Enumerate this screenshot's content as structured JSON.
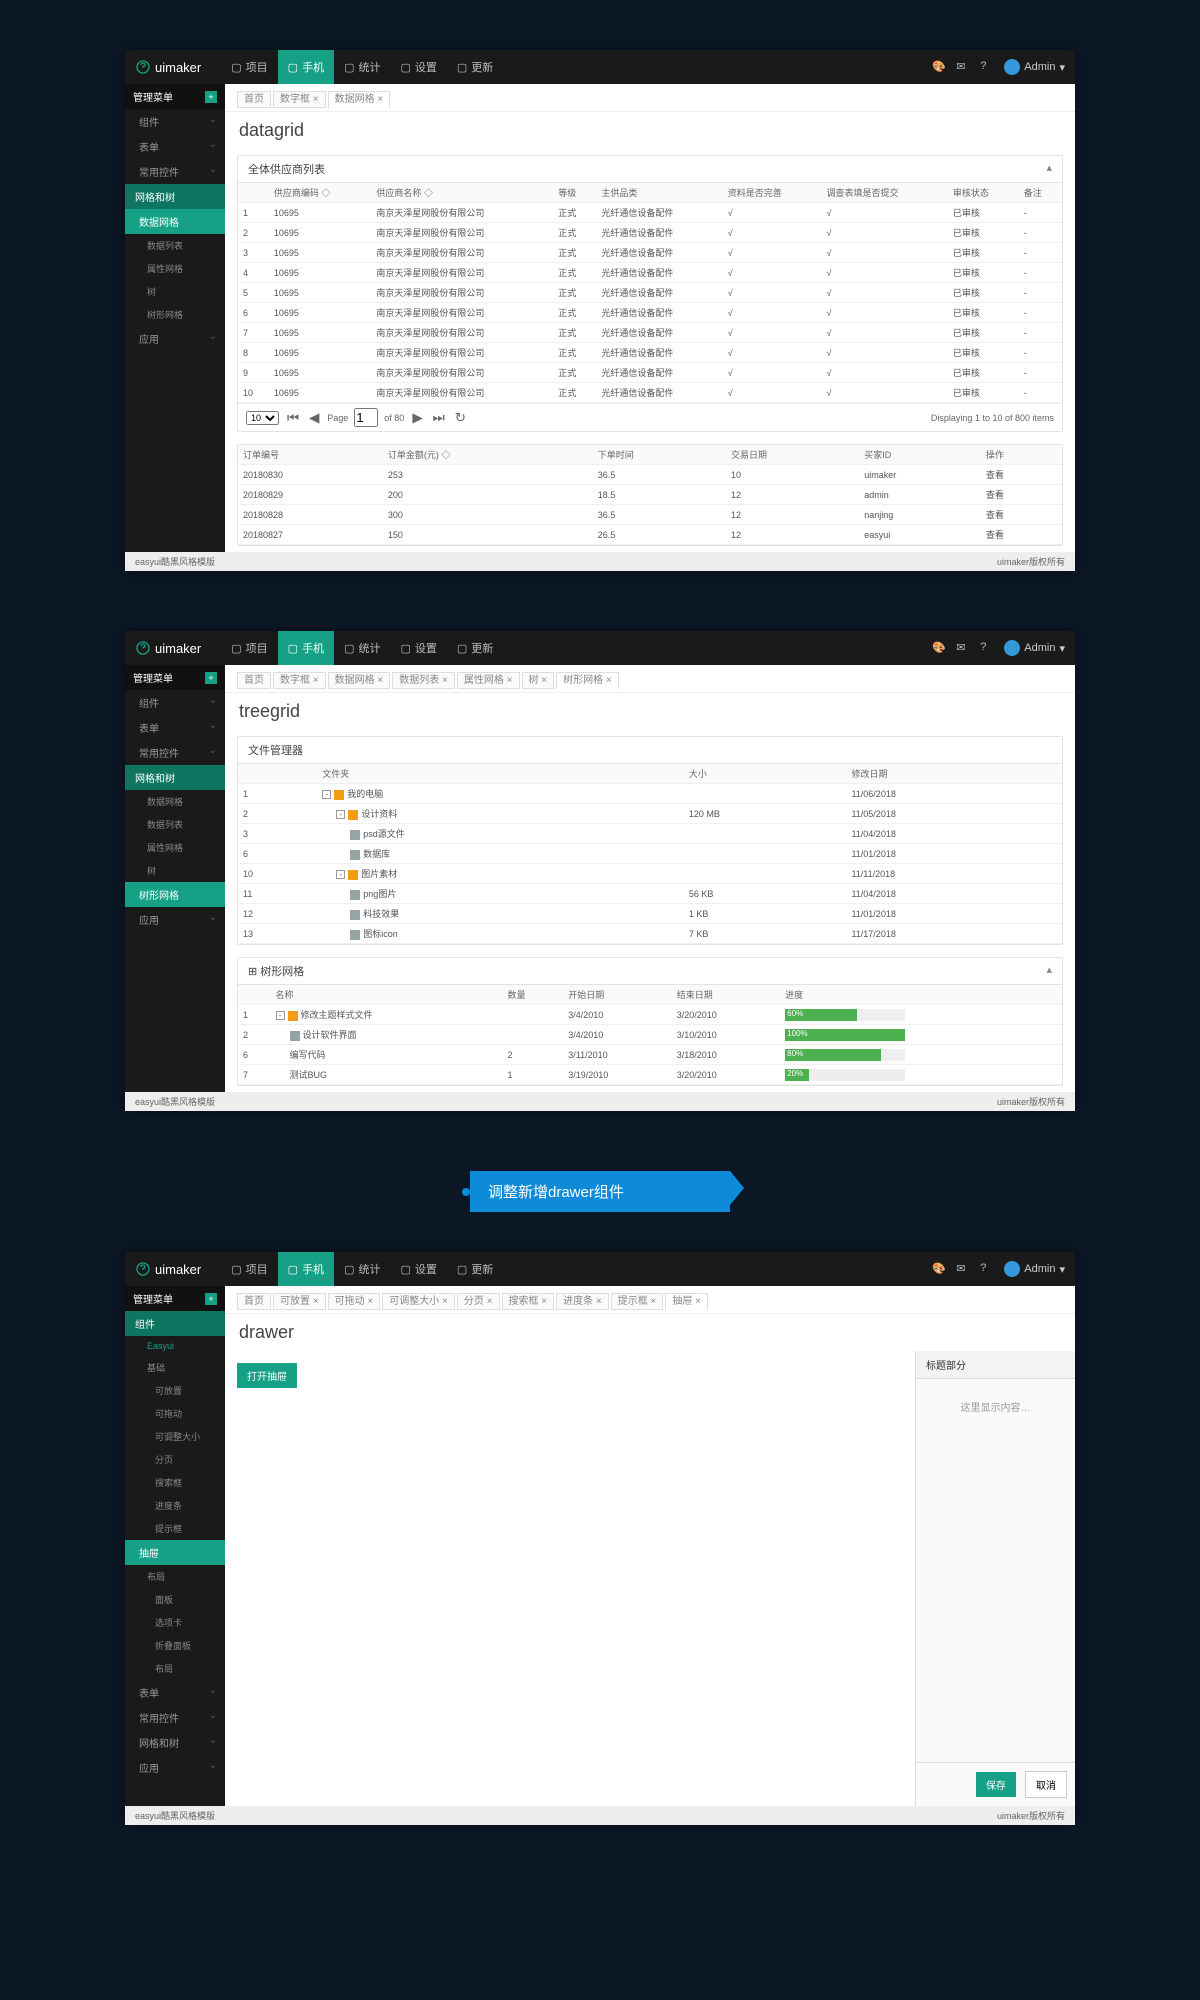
{
  "brand": "uimaker",
  "topnav": [
    {
      "icon": "monitor",
      "label": "项目"
    },
    {
      "icon": "mobile",
      "label": "手机"
    },
    {
      "icon": "chart",
      "label": "统计"
    },
    {
      "icon": "gear",
      "label": "设置"
    },
    {
      "icon": "refresh",
      "label": "更新"
    }
  ],
  "user": "Admin",
  "sidebar_title": "管理菜单",
  "footer_left": "easyui酷黑风格模版",
  "footer_right": "uimaker版权所有",
  "shot1": {
    "sidebar": [
      {
        "label": "组件",
        "caret": true
      },
      {
        "label": "表单",
        "caret": true
      },
      {
        "label": "常用控件",
        "caret": true
      },
      {
        "label": "网格和树",
        "sec": true,
        "active_alt": true
      },
      {
        "label": "数据网格",
        "active": true
      },
      {
        "label": "数据列表",
        "sub": true
      },
      {
        "label": "属性网格",
        "sub": true
      },
      {
        "label": "树",
        "sub": true
      },
      {
        "label": "树形网格",
        "sub": true
      },
      {
        "label": "应用",
        "caret": true,
        "bottom": true
      }
    ],
    "crumbs": [
      "首页",
      "数字框",
      "数据网格"
    ],
    "title": "datagrid",
    "panel1": {
      "title": "全体供应商列表",
      "cols": [
        "",
        "供应商编码 ◇",
        "供应商名称 ◇",
        "等级",
        "主供品类",
        "资料是否完善",
        "调查表填是否提交",
        "审核状态",
        "备注"
      ],
      "rows": [
        [
          "1",
          "10695",
          "南京天泽星网股份有限公司",
          "正式",
          "光纤通信设备配件",
          "√",
          "√",
          "已审核",
          "-"
        ],
        [
          "2",
          "10695",
          "南京天泽星网股份有限公司",
          "正式",
          "光纤通信设备配件",
          "√",
          "√",
          "已审核",
          "-"
        ],
        [
          "3",
          "10695",
          "南京天泽星网股份有限公司",
          "正式",
          "光纤通信设备配件",
          "√",
          "√",
          "已审核",
          "-"
        ],
        [
          "4",
          "10695",
          "南京天泽星网股份有限公司",
          "正式",
          "光纤通信设备配件",
          "√",
          "√",
          "已审核",
          "-"
        ],
        [
          "5",
          "10695",
          "南京天泽星网股份有限公司",
          "正式",
          "光纤通信设备配件",
          "√",
          "√",
          "已审核",
          "-"
        ],
        [
          "6",
          "10695",
          "南京天泽星网股份有限公司",
          "正式",
          "光纤通信设备配件",
          "√",
          "√",
          "已审核",
          "-"
        ],
        [
          "7",
          "10695",
          "南京天泽星网股份有限公司",
          "正式",
          "光纤通信设备配件",
          "√",
          "√",
          "已审核",
          "-"
        ],
        [
          "8",
          "10695",
          "南京天泽星网股份有限公司",
          "正式",
          "光纤通信设备配件",
          "√",
          "√",
          "已审核",
          "-"
        ],
        [
          "9",
          "10695",
          "南京天泽星网股份有限公司",
          "正式",
          "光纤通信设备配件",
          "√",
          "√",
          "已审核",
          "-"
        ],
        [
          "10",
          "10695",
          "南京天泽星网股份有限公司",
          "正式",
          "光纤通信设备配件",
          "√",
          "√",
          "已审核",
          "-"
        ]
      ],
      "pager": {
        "size": "10",
        "page": "1",
        "of": "of 80",
        "display": "Displaying 1 to 10 of 800 items"
      }
    },
    "panel2": {
      "cols": [
        "订单编号",
        "订单金额(元) ◇",
        "下单时间",
        "交易日期",
        "买家ID",
        "操作"
      ],
      "rows": [
        [
          "20180830",
          "253",
          "36.5",
          "10",
          "uimaker",
          "查看"
        ],
        [
          "20180829",
          "200",
          "18.5",
          "12",
          "admin",
          "查看"
        ],
        [
          "20180828",
          "300",
          "36.5",
          "12",
          "nanjing",
          "查看"
        ],
        [
          "20180827",
          "150",
          "26.5",
          "12",
          "easyui",
          "查看"
        ]
      ]
    }
  },
  "shot2": {
    "sidebar": [
      {
        "label": "组件",
        "caret": true
      },
      {
        "label": "表单",
        "caret": true
      },
      {
        "label": "常用控件",
        "caret": true
      },
      {
        "label": "网格和树",
        "sec": true,
        "active_alt": true
      },
      {
        "label": "数据网格",
        "sub": true
      },
      {
        "label": "数据列表",
        "sub": true
      },
      {
        "label": "属性网格",
        "sub": true
      },
      {
        "label": "树",
        "sub": true
      },
      {
        "label": "树形网格",
        "active": true
      },
      {
        "label": "应用",
        "caret": true,
        "bottom": true
      }
    ],
    "crumbs": [
      "首页",
      "数字框",
      "数据网格",
      "数据列表",
      "属性网格",
      "树",
      "树形网格"
    ],
    "title": "treegrid",
    "panel1": {
      "title": "文件管理器",
      "cols": [
        "",
        "文件夹",
        "大小",
        "修改日期"
      ],
      "rows": [
        {
          "n": "1",
          "indent": 0,
          "ex": "-",
          "icon": "folder",
          "name": "我的电脑",
          "size": "",
          "date": "11/06/2018"
        },
        {
          "n": "2",
          "indent": 1,
          "ex": "-",
          "icon": "folder",
          "name": "设计资料",
          "size": "120 MB",
          "date": "11/05/2018"
        },
        {
          "n": "3",
          "indent": 2,
          "ex": "",
          "icon": "file",
          "name": "psd源文件",
          "size": "",
          "date": "11/04/2018"
        },
        {
          "n": "6",
          "indent": 2,
          "ex": "",
          "icon": "file",
          "name": "数据库",
          "size": "",
          "date": "11/01/2018"
        },
        {
          "n": "10",
          "indent": 1,
          "ex": "-",
          "icon": "folder",
          "name": "图片素材",
          "size": "",
          "date": "11/11/2018"
        },
        {
          "n": "11",
          "indent": 2,
          "ex": "",
          "icon": "file",
          "name": "png图片",
          "size": "56 KB",
          "date": "11/04/2018"
        },
        {
          "n": "12",
          "indent": 2,
          "ex": "",
          "icon": "file",
          "name": "科技效果",
          "size": "1 KB",
          "date": "11/01/2018"
        },
        {
          "n": "13",
          "indent": 2,
          "ex": "",
          "icon": "file",
          "name": "图标icon",
          "size": "7 KB",
          "date": "11/17/2018"
        }
      ]
    },
    "panel2": {
      "title": "树形网格",
      "cols": [
        "",
        "名称",
        "数量",
        "开始日期",
        "结束日期",
        "进度"
      ],
      "rows": [
        {
          "n": "1",
          "indent": 0,
          "ex": "-",
          "icon": "folder",
          "name": "修改主题样式文件",
          "qty": "",
          "start": "3/4/2010",
          "end": "3/20/2010",
          "prog": 60
        },
        {
          "n": "2",
          "indent": 1,
          "ex": "",
          "icon": "file",
          "name": "设计软件界面",
          "qty": "",
          "start": "3/4/2010",
          "end": "3/10/2010",
          "prog": 100
        },
        {
          "n": "6",
          "indent": 1,
          "ex": "",
          "icon": "",
          "name": "编写代码",
          "qty": "2",
          "start": "3/11/2010",
          "end": "3/18/2010",
          "prog": 80
        },
        {
          "n": "7",
          "indent": 1,
          "ex": "",
          "icon": "",
          "name": "测试BUG",
          "qty": "1",
          "start": "3/19/2010",
          "end": "3/20/2010",
          "prog": 20
        }
      ]
    }
  },
  "callout": "调整新增drawer组件",
  "shot3": {
    "sidebar": [
      {
        "label": "组件",
        "sec": true,
        "active_alt": true
      },
      {
        "label": "Easyui",
        "sub": true,
        "hover": true
      },
      {
        "label": "基础",
        "sub": true
      },
      {
        "label": "可放置",
        "sub2": true
      },
      {
        "label": "可拖动",
        "sub2": true
      },
      {
        "label": "可调整大小",
        "sub2": true
      },
      {
        "label": "分页",
        "sub2": true
      },
      {
        "label": "搜索框",
        "sub2": true
      },
      {
        "label": "进度条",
        "sub2": true
      },
      {
        "label": "提示框",
        "sub2": true
      },
      {
        "label": "抽屉",
        "active": true
      },
      {
        "label": "布局",
        "sub": true
      },
      {
        "label": "面板",
        "sub2": true
      },
      {
        "label": "选项卡",
        "sub2": true
      },
      {
        "label": "折叠面板",
        "sub2": true
      },
      {
        "label": "布局",
        "sub2": true
      },
      {
        "label": "表单",
        "caret": true
      },
      {
        "label": "常用控件",
        "caret": true
      },
      {
        "label": "网格和树",
        "caret": true
      },
      {
        "label": "应用",
        "caret": true
      }
    ],
    "crumbs": [
      "首页",
      "可放置",
      "可拖动",
      "可调整大小",
      "分页",
      "搜索框",
      "进度条",
      "提示框",
      "抽屉"
    ],
    "title": "drawer",
    "open_btn": "打开抽屉",
    "drawer": {
      "title": "标题部分",
      "content": "这里显示内容…",
      "save": "保存",
      "cancel": "取消"
    }
  }
}
